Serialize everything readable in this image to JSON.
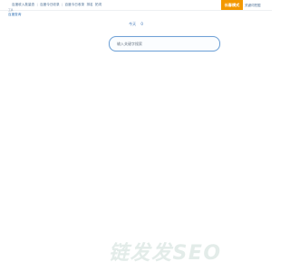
{
  "topnav": {
    "items": [
      "百度收入批量查",
      "百度今日收录",
      "百度今日收录",
      "排名",
      "拓词"
    ],
    "separator": "|"
  },
  "top_right": {
    "mode_button": "长春模式",
    "link": "关键词挖掘"
  },
  "sub_header": {
    "small_text": "工具",
    "link": "百度查询"
  },
  "date_row": {
    "label": "今天",
    "count": "0"
  },
  "search": {
    "placeholder": "输入关键字搜索",
    "value": ""
  },
  "watermark": {
    "text": "链发发SEO"
  },
  "colors": {
    "accent_orange": "#f39800",
    "link_blue": "#2e6fb3",
    "search_border": "#6fa1d6",
    "watermark": "#e3ece9"
  }
}
